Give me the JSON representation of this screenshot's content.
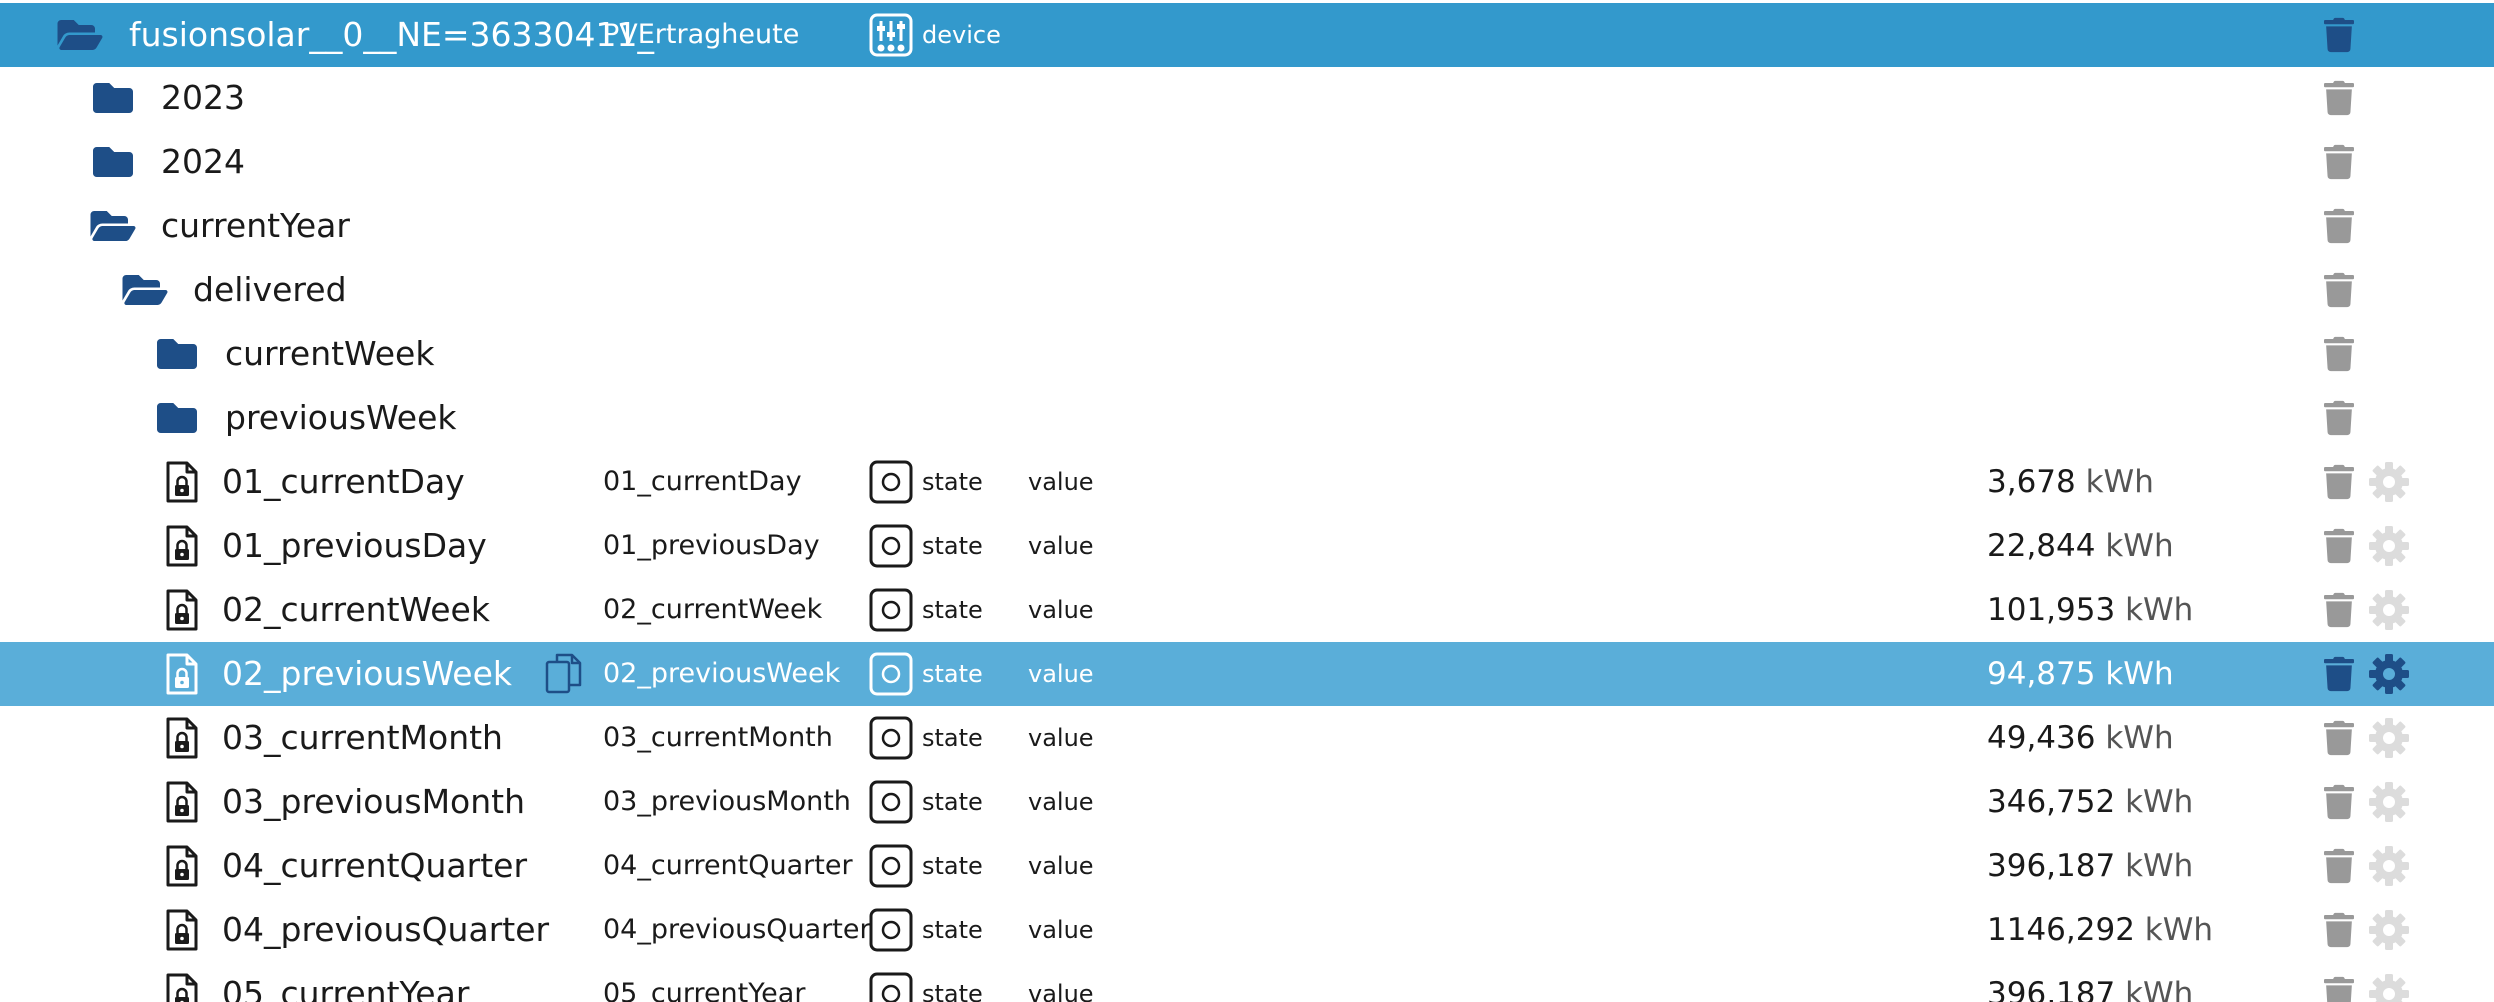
{
  "colors": {
    "root_selection": "#3399cc",
    "row_selection": "#5aaed9",
    "folder_icon": "#1e4e87",
    "muted_icon": "#999999"
  },
  "tree": {
    "root": {
      "name": "fusionsolar__0__NE=36330411_",
      "object_name": "PVErtragheute",
      "type": "device",
      "icons": [
        "folder-open-icon",
        "device-icon",
        "trash-icon"
      ]
    },
    "folders": [
      {
        "name": "2023",
        "icon": "folder-icon"
      },
      {
        "name": "2024",
        "icon": "folder-icon"
      },
      {
        "name": "currentYear",
        "icon": "folder-open-icon"
      },
      {
        "name": "delivered",
        "icon": "folder-open-icon"
      },
      {
        "name": "currentWeek",
        "icon": "folder-icon"
      },
      {
        "name": "previousWeek",
        "icon": "folder-icon"
      }
    ],
    "states": [
      {
        "id": "01_currentDay",
        "name": "01_currentDay",
        "type": "state",
        "role": "value",
        "value": "3,678",
        "unit": "kWh",
        "selected": false
      },
      {
        "id": "01_previousDay",
        "name": "01_previousDay",
        "type": "state",
        "role": "value",
        "value": "22,844",
        "unit": "kWh",
        "selected": false
      },
      {
        "id": "02_currentWeek",
        "name": "02_currentWeek",
        "type": "state",
        "role": "value",
        "value": "101,953",
        "unit": "kWh",
        "selected": false
      },
      {
        "id": "02_previousWeek",
        "name": "02_previousWeek",
        "type": "state",
        "role": "value",
        "value": "94,875",
        "unit": "kWh",
        "selected": true
      },
      {
        "id": "03_currentMonth",
        "name": "03_currentMonth",
        "type": "state",
        "role": "value",
        "value": "49,436",
        "unit": "kWh",
        "selected": false
      },
      {
        "id": "03_previousMonth",
        "name": "03_previousMonth",
        "type": "state",
        "role": "value",
        "value": "346,752",
        "unit": "kWh",
        "selected": false
      },
      {
        "id": "04_currentQuarter",
        "name": "04_currentQuarter",
        "type": "state",
        "role": "value",
        "value": "396,187",
        "unit": "kWh",
        "selected": false
      },
      {
        "id": "04_previousQuarter",
        "name": "04_previousQuarter",
        "type": "state",
        "role": "value",
        "value": "1146,292",
        "unit": "kWh",
        "selected": false
      },
      {
        "id": "05_currentYear",
        "name": "05_currentYear",
        "type": "state",
        "role": "value",
        "value": "396,187",
        "unit": "kWh",
        "selected": false
      }
    ]
  }
}
